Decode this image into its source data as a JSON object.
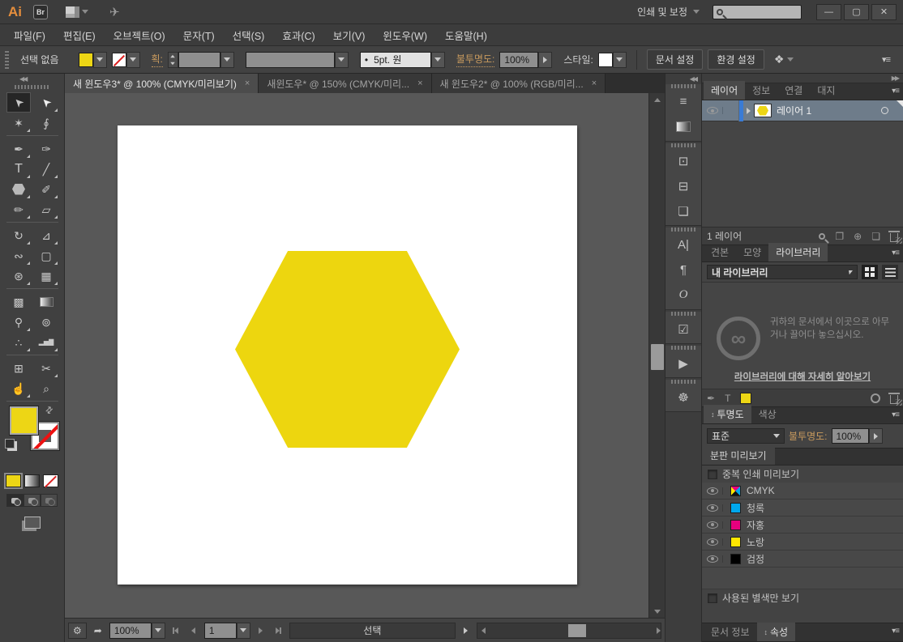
{
  "titlebar": {
    "logo": "Ai",
    "bridge": "Br",
    "workspace_switcher": "인쇄 및 보정",
    "search_value": "",
    "gpu_icon_glyph": "✈",
    "minimize": "—",
    "maximize": "▢",
    "close": "✕"
  },
  "menubar": [
    "파일(F)",
    "편집(E)",
    "오브젝트(O)",
    "문자(T)",
    "선택(S)",
    "효과(C)",
    "보기(V)",
    "윈도우(W)",
    "도움말(H)"
  ],
  "control_bar": {
    "selection_status": "선택 없음",
    "stroke_label": "획:",
    "brush_bullet": "•",
    "brush_preset": "5pt. 원",
    "opacity_label": "불투명도:",
    "opacity_value": "100%",
    "style_label": "스타일:",
    "doc_setup": "문서 설정",
    "preferences": "환경 설정",
    "select_similar_glyph": "❖",
    "panel_menu_glyph": "▾≡"
  },
  "document_tabs": [
    {
      "label": "새 윈도우3* @ 100% (CMYK/미리보기)",
      "close": "×"
    },
    {
      "label": "새윈도우* @ 150% (CMYK/미리...",
      "close": "×"
    },
    {
      "label": "새 윈도우2* @ 100% (RGB/미리...",
      "close": "×"
    }
  ],
  "collapse_glyphs": {
    "left": "◀◀",
    "right": "▶▶"
  },
  "tools": [
    {
      "name": "selection",
      "glyph": "➤"
    },
    {
      "name": "direct-selection",
      "glyph": "➤"
    },
    {
      "name": "magic-wand",
      "glyph": "✶"
    },
    {
      "name": "lasso",
      "glyph": "∮"
    },
    {
      "name": "pen",
      "glyph": "✒"
    },
    {
      "name": "curvature",
      "glyph": "✑"
    },
    {
      "name": "type",
      "glyph": "T"
    },
    {
      "name": "line-segment",
      "glyph": "╱"
    },
    {
      "name": "polygon",
      "glyph": ""
    },
    {
      "name": "paintbrush",
      "glyph": "✐"
    },
    {
      "name": "pencil",
      "glyph": "✏"
    },
    {
      "name": "eraser",
      "glyph": "▱"
    },
    {
      "name": "rotate",
      "glyph": "↻"
    },
    {
      "name": "scale",
      "glyph": "⊿"
    },
    {
      "name": "width",
      "glyph": "∾"
    },
    {
      "name": "free-transform",
      "glyph": "▢"
    },
    {
      "name": "shape-builder",
      "glyph": "⊛"
    },
    {
      "name": "perspective-grid",
      "glyph": "▦"
    },
    {
      "name": "mesh",
      "glyph": "▩"
    },
    {
      "name": "gradient",
      "glyph": ""
    },
    {
      "name": "eyedropper",
      "glyph": "⚲"
    },
    {
      "name": "blend",
      "glyph": "⊚"
    },
    {
      "name": "symbol-sprayer",
      "glyph": "∴"
    },
    {
      "name": "graph",
      "glyph": "▂▅▇"
    },
    {
      "name": "artboard",
      "glyph": "⊞"
    },
    {
      "name": "slice",
      "glyph": "✂"
    },
    {
      "name": "hand",
      "glyph": "☝"
    },
    {
      "name": "zoom",
      "glyph": "⌕"
    }
  ],
  "toolbar_extras": {
    "swap_glyph": "⇄",
    "screen_mode": ""
  },
  "dock_icons": [
    {
      "name": "stroke-panel",
      "glyph": "≡"
    },
    {
      "name": "gradient-panel",
      "glyph": ""
    },
    {
      "name": "transform-panel",
      "glyph": "⊡"
    },
    {
      "name": "align-panel",
      "glyph": "⊟"
    },
    {
      "name": "pathfinder-panel",
      "glyph": "❏"
    },
    {
      "name": "character-panel",
      "glyph": "A|"
    },
    {
      "name": "paragraph-panel",
      "glyph": "¶"
    },
    {
      "name": "opentype-panel",
      "glyph": "O"
    },
    {
      "name": "attributes-panel",
      "glyph": "☑"
    },
    {
      "name": "actions-panel",
      "glyph": "▶"
    },
    {
      "name": "navigator-panel",
      "glyph": "☸"
    }
  ],
  "layers_panel": {
    "tabs": [
      "레이어",
      "정보",
      "연결",
      "대지"
    ],
    "layer_name": "레이어 1",
    "count_label": "1 레이어",
    "clip_icon_glyph": "❐",
    "sublayer_icon_glyph": "⊕",
    "newlayer_icon_glyph": "❏",
    "panel_menu_glyph": "▾≡"
  },
  "libraries_panel": {
    "tabs": [
      "견본",
      "모양",
      "라이브러리"
    ],
    "dropdown": "내 라이브러리",
    "cc_glyph": "∞",
    "empty_text": "귀하의 문서에서 이곳으로 아무거나 끌어다 놓으십시오.",
    "link": "라이브러리에 대해 자세히 알아보기",
    "add_graphic_glyph": "✒",
    "add_type_glyph": "T",
    "panel_menu_glyph": "▾≡"
  },
  "transparency_panel": {
    "tabs": [
      "투명도",
      "색상"
    ],
    "updown_glyph": "↕",
    "blend_mode": "표준",
    "opacity_label": "불투명도:",
    "opacity_value": "100%",
    "panel_menu_glyph": "▾≡"
  },
  "separations_panel": {
    "title": "분판 미리보기",
    "overprint_checkbox": "중복 인쇄 미리보기",
    "rows": [
      {
        "name": "CMYK",
        "swatch_style": "background:conic-gradient(from 45deg, #00a8ec 0 25%, #111111 25% 50%, #ffe600 50% 75%, #e6007e 75% 100%)"
      },
      {
        "name": "청록",
        "swatch_style": "background:#00a8ec"
      },
      {
        "name": "자홍",
        "swatch_style": "background:#e6007e"
      },
      {
        "name": "노랑",
        "swatch_style": "background:#ffe600"
      },
      {
        "name": "검정",
        "swatch_style": "background:#000000"
      }
    ],
    "spot_checkbox": "사용된 별색만 보기"
  },
  "bottom_tabs": {
    "doc_info": "문서 정보",
    "properties": "속성",
    "updown_glyph": "↕",
    "panel_menu_glyph": "▾≡"
  },
  "status_bar": {
    "zoom": "100%",
    "artboard": "1",
    "status": "선택",
    "gear_glyph": "⚙",
    "export_glyph": "➦"
  },
  "styles": {
    "yellow": "background:#edd615",
    "hexagon": "background:#edd60f"
  },
  "canvas": {
    "hexagon_color": "#edd60f"
  }
}
